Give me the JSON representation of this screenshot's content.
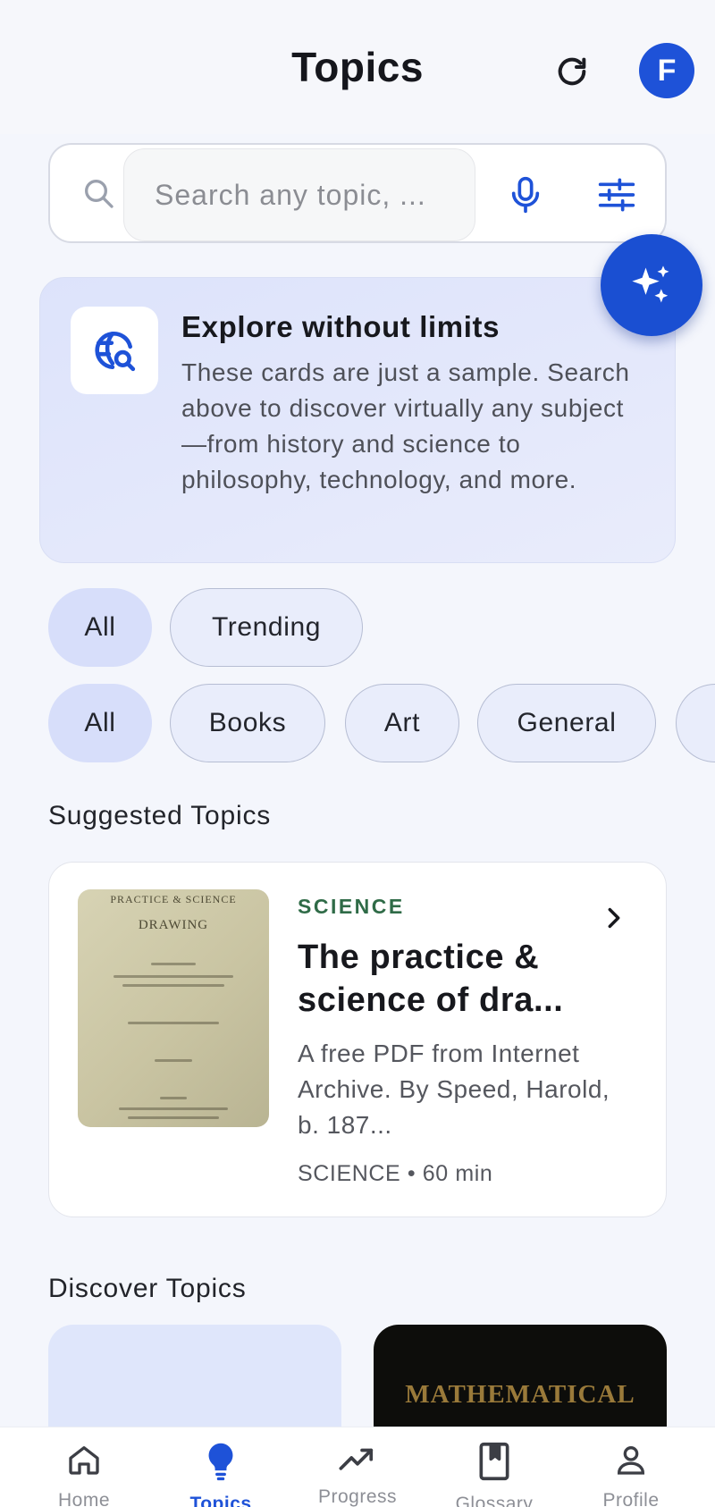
{
  "header": {
    "title": "Topics",
    "avatar_initial": "F"
  },
  "search": {
    "placeholder": "Search any topic, ..."
  },
  "info_card": {
    "title": "Explore without limits",
    "body": "These cards are just a sample. Search above to discover virtually any subject—from history and science to philosophy, technology, and more."
  },
  "filters_row1": [
    "All",
    "Trending"
  ],
  "filters_row2": [
    "All",
    "Books",
    "Art",
    "General",
    ""
  ],
  "suggested": {
    "heading": "Suggested Topics",
    "card": {
      "category": "SCIENCE",
      "title": "The practice & science of dra...",
      "description": "A free PDF from Internet Archive. By Speed, Harold, b. 187...",
      "meta": "SCIENCE • 60 min",
      "cover_line1": "PRACTICE & SCIENCE",
      "cover_line2": "DRAWING"
    }
  },
  "discover": {
    "heading": "Discover Topics",
    "card2_text": "MATHEMATICAL"
  },
  "nav": [
    {
      "label": "Home",
      "icon": "home-icon",
      "active": false
    },
    {
      "label": "Topics",
      "icon": "lightbulb-icon",
      "active": true
    },
    {
      "label": "Progress",
      "icon": "trending-up-icon",
      "active": false
    },
    {
      "label": "Glossary",
      "icon": "book-icon",
      "active": false
    },
    {
      "label": "Profile",
      "icon": "person-icon",
      "active": false
    }
  ],
  "colors": {
    "accent": "#1e52d8",
    "category_green": "#2f6b47",
    "chip_bg": "#e9edfb",
    "chip_active_bg": "#d7defa"
  }
}
